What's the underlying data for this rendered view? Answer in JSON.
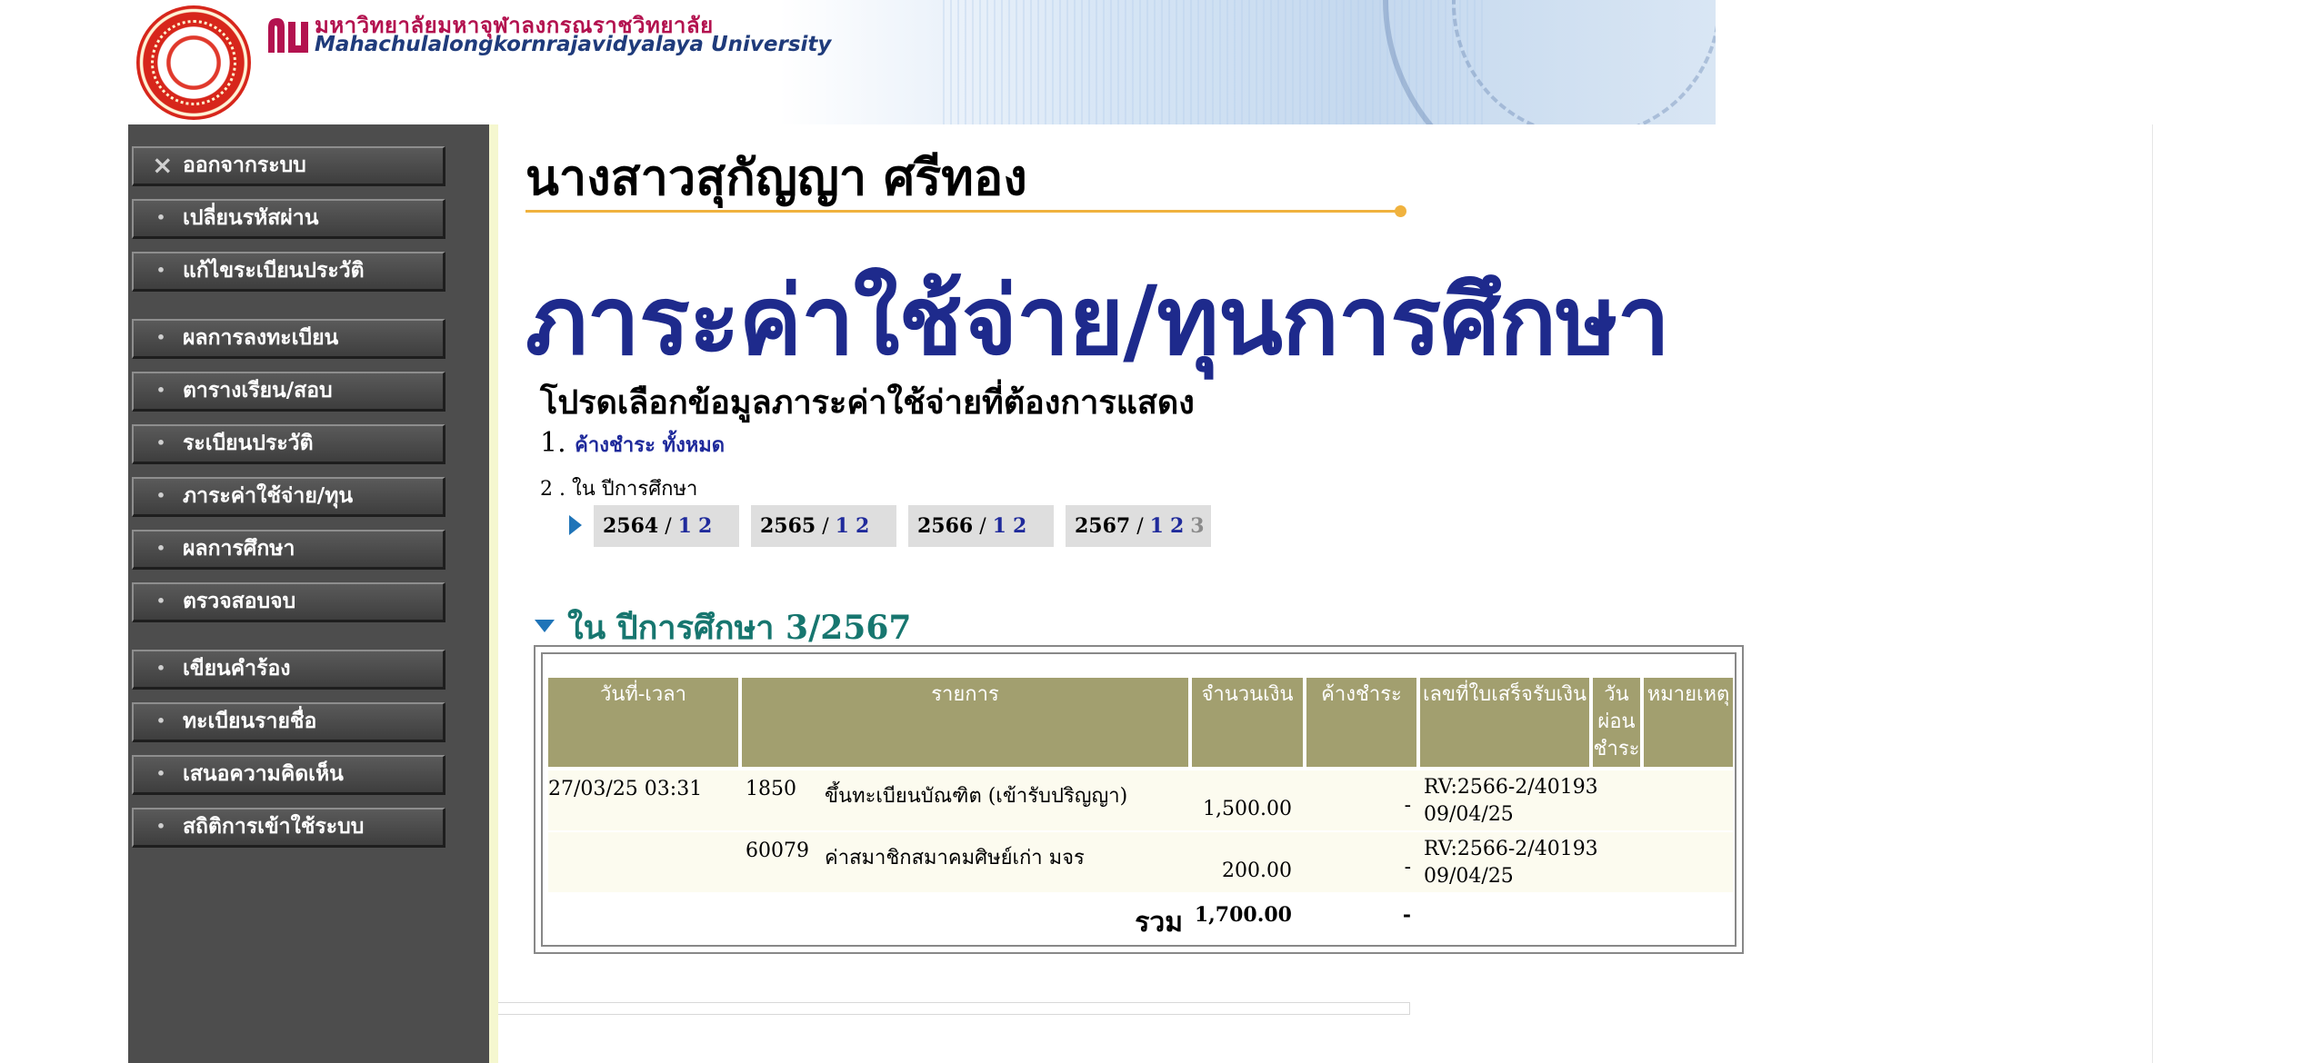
{
  "header": {
    "university_th": "มหาวิทยาลัยมหาจุฬาลงกรณราชวิทยาลัย",
    "university_en": "Mahachulalongkornrajavidyalaya University",
    "brand_color": "#b3124f"
  },
  "sidebar": {
    "items": [
      {
        "label": "ออกจากระบบ",
        "icon": "close-icon"
      },
      {
        "label": "เปลี่ยนรหัสผ่าน",
        "icon": "bullet-icon"
      },
      {
        "label": "แก้ไขระเบียนประวัติ",
        "icon": "bullet-icon"
      },
      {
        "label": "ผลการลงทะเบียน",
        "icon": "bullet-icon"
      },
      {
        "label": "ตารางเรียน/สอบ",
        "icon": "bullet-icon"
      },
      {
        "label": "ระเบียนประวัติ",
        "icon": "bullet-icon"
      },
      {
        "label": "ภาระค่าใช้จ่าย/ทุน",
        "icon": "bullet-icon"
      },
      {
        "label": "ผลการศึกษา",
        "icon": "bullet-icon"
      },
      {
        "label": "ตรวจสอบจบ",
        "icon": "bullet-icon"
      },
      {
        "label": "เขียนคำร้อง",
        "icon": "bullet-icon"
      },
      {
        "label": "ทะเบียนรายชื่อ",
        "icon": "bullet-icon"
      },
      {
        "label": "เสนอความคิดเห็น",
        "icon": "bullet-icon"
      },
      {
        "label": "สถิติการเข้าใช้ระบบ",
        "icon": "bullet-icon"
      }
    ]
  },
  "main": {
    "student_name": "นางสาวสุกัญญา ศรีทอง",
    "page_title": "ภาระค่าใช้จ่าย/ทุนการศึกษา",
    "prompt": "โปรดเลือกข้อมูลภาระค่าใช้จ่ายที่ต้องการแสดง",
    "option1_number": "1.",
    "option1_link": "ค้างชำระ ทั้งหมด",
    "option2_label": "2 . ใน ปีการศึกษา",
    "years": [
      {
        "year": "2564",
        "sep": "/",
        "terms": [
          "1",
          "2"
        ]
      },
      {
        "year": "2565",
        "sep": "/",
        "terms": [
          "1",
          "2"
        ]
      },
      {
        "year": "2566",
        "sep": "/",
        "terms": [
          "1",
          "2"
        ]
      },
      {
        "year": "2567",
        "sep": "/",
        "terms": [
          "1",
          "2"
        ],
        "muted_term": "3"
      }
    ],
    "section_heading": "ใน ปีการศึกษา 3/2567"
  },
  "table": {
    "headers": {
      "datetime": "วันที่-เวลา",
      "item": "รายการ",
      "amount": "จำนวนเงิน",
      "outstanding": "ค้างชำระ",
      "receipt": "เลขที่ใบเสร็จรับเงิน",
      "installment_1": "วัน",
      "installment_2": "ผ่อน",
      "installment_3": "ชำระ",
      "note": "หมายเหตุ"
    },
    "rows": [
      {
        "datetime": "27/03/25 03:31",
        "code": "1850",
        "desc": "ขึ้นทะเบียนบัณฑิต (เข้ารับปริญญา)",
        "amount": "1,500.00",
        "outstanding": "-",
        "receipt_no": "RV:2566-2/40193",
        "receipt_date": "09/04/25"
      },
      {
        "datetime": "",
        "code": "60079",
        "desc": "ค่าสมาชิกสมาคมศิษย์เก่า มจร",
        "amount": "200.00",
        "outstanding": "-",
        "receipt_no": "RV:2566-2/40193",
        "receipt_date": "09/04/25"
      }
    ],
    "total_label": "รวม",
    "total_amount": "1,700.00",
    "total_outstanding": "-"
  }
}
